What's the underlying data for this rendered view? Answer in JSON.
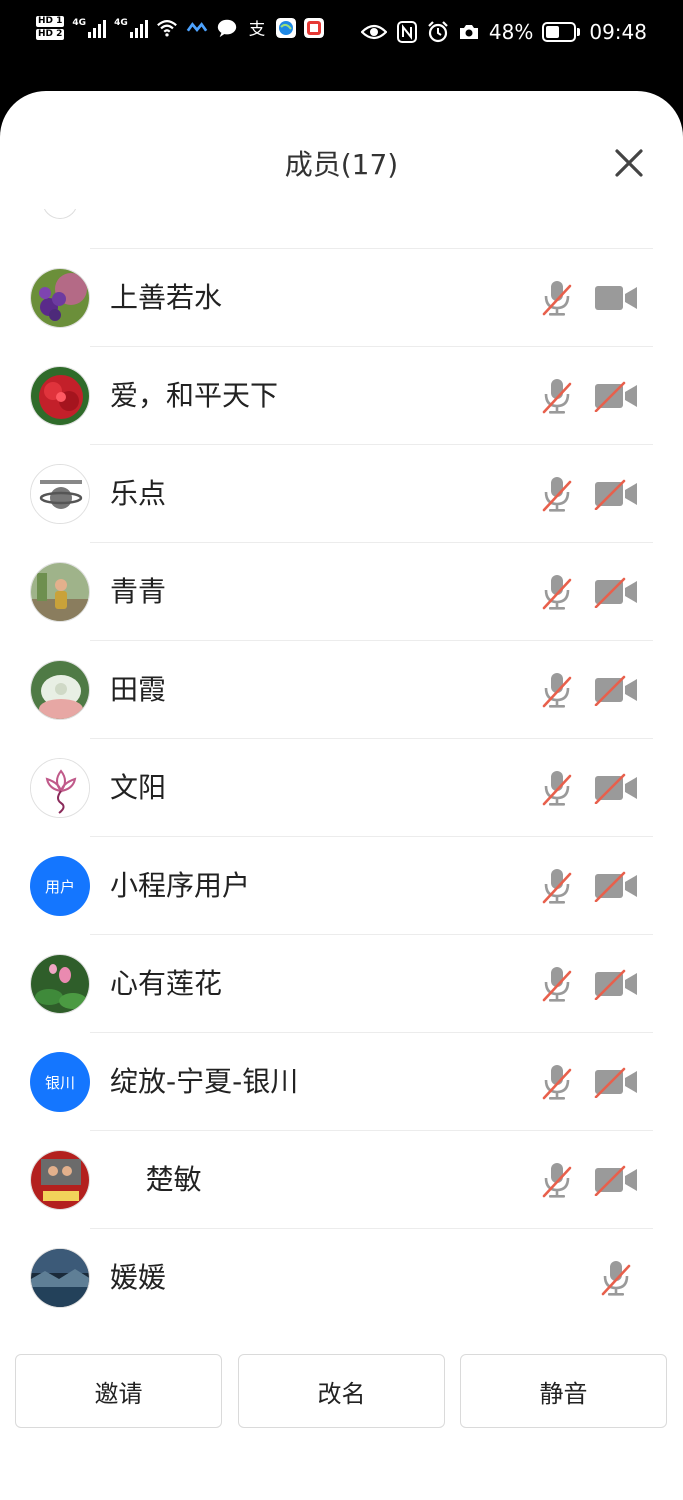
{
  "status_bar": {
    "network_labels": [
      "HD 1",
      "HD 2",
      "4G",
      "4G"
    ],
    "battery_percent": "48%",
    "time": "09:48",
    "battery_level": 0.48,
    "icons": [
      "signal-icon",
      "wifi-icon",
      "messaging-app-icon",
      "chat-icon",
      "alipay-icon",
      "browser-icon",
      "app-icon",
      "eye-icon",
      "nfc-icon",
      "alarm-icon",
      "camera-icon",
      "battery-icon"
    ]
  },
  "sheet": {
    "title": "成员(17)",
    "close_icon": "close-icon"
  },
  "members": [
    {
      "name": "上善若水",
      "avatar": "photo-purple-flowers",
      "mic": "muted",
      "camera": "on"
    },
    {
      "name": "爱，和平天下",
      "avatar": "photo-red-flowers",
      "mic": "muted",
      "camera": "off"
    },
    {
      "name": "乐点",
      "avatar": "photo-planet-logo",
      "mic": "muted",
      "camera": "off"
    },
    {
      "name": "青青",
      "avatar": "photo-person-outdoors",
      "mic": "muted",
      "camera": "off"
    },
    {
      "name": "田霞",
      "avatar": "photo-white-flower",
      "mic": "muted",
      "camera": "off"
    },
    {
      "name": "文阳",
      "avatar": "photo-lotus-drawing",
      "mic": "muted",
      "camera": "off"
    },
    {
      "name": "小程序用户",
      "avatar_text": "用户",
      "mic": "muted",
      "camera": "off"
    },
    {
      "name": "心有莲花",
      "avatar": "photo-lotus-pond",
      "mic": "muted",
      "camera": "off"
    },
    {
      "name": "绽放-宁夏-银川",
      "avatar_text": "银川",
      "mic": "muted",
      "camera": "off"
    },
    {
      "name": "    楚敏",
      "avatar": "photo-red-group",
      "mic": "muted",
      "camera": "off"
    },
    {
      "name": "媛媛",
      "avatar": "photo-landscape",
      "mic": "muted",
      "camera": "none"
    }
  ],
  "colors": {
    "icon_gray": "#9a9a9a",
    "muted_slash": "#e8604c",
    "avatar_blue": "#1476ff"
  },
  "footer": {
    "invite_label": "邀请",
    "rename_label": "改名",
    "mute_label": "静音"
  }
}
